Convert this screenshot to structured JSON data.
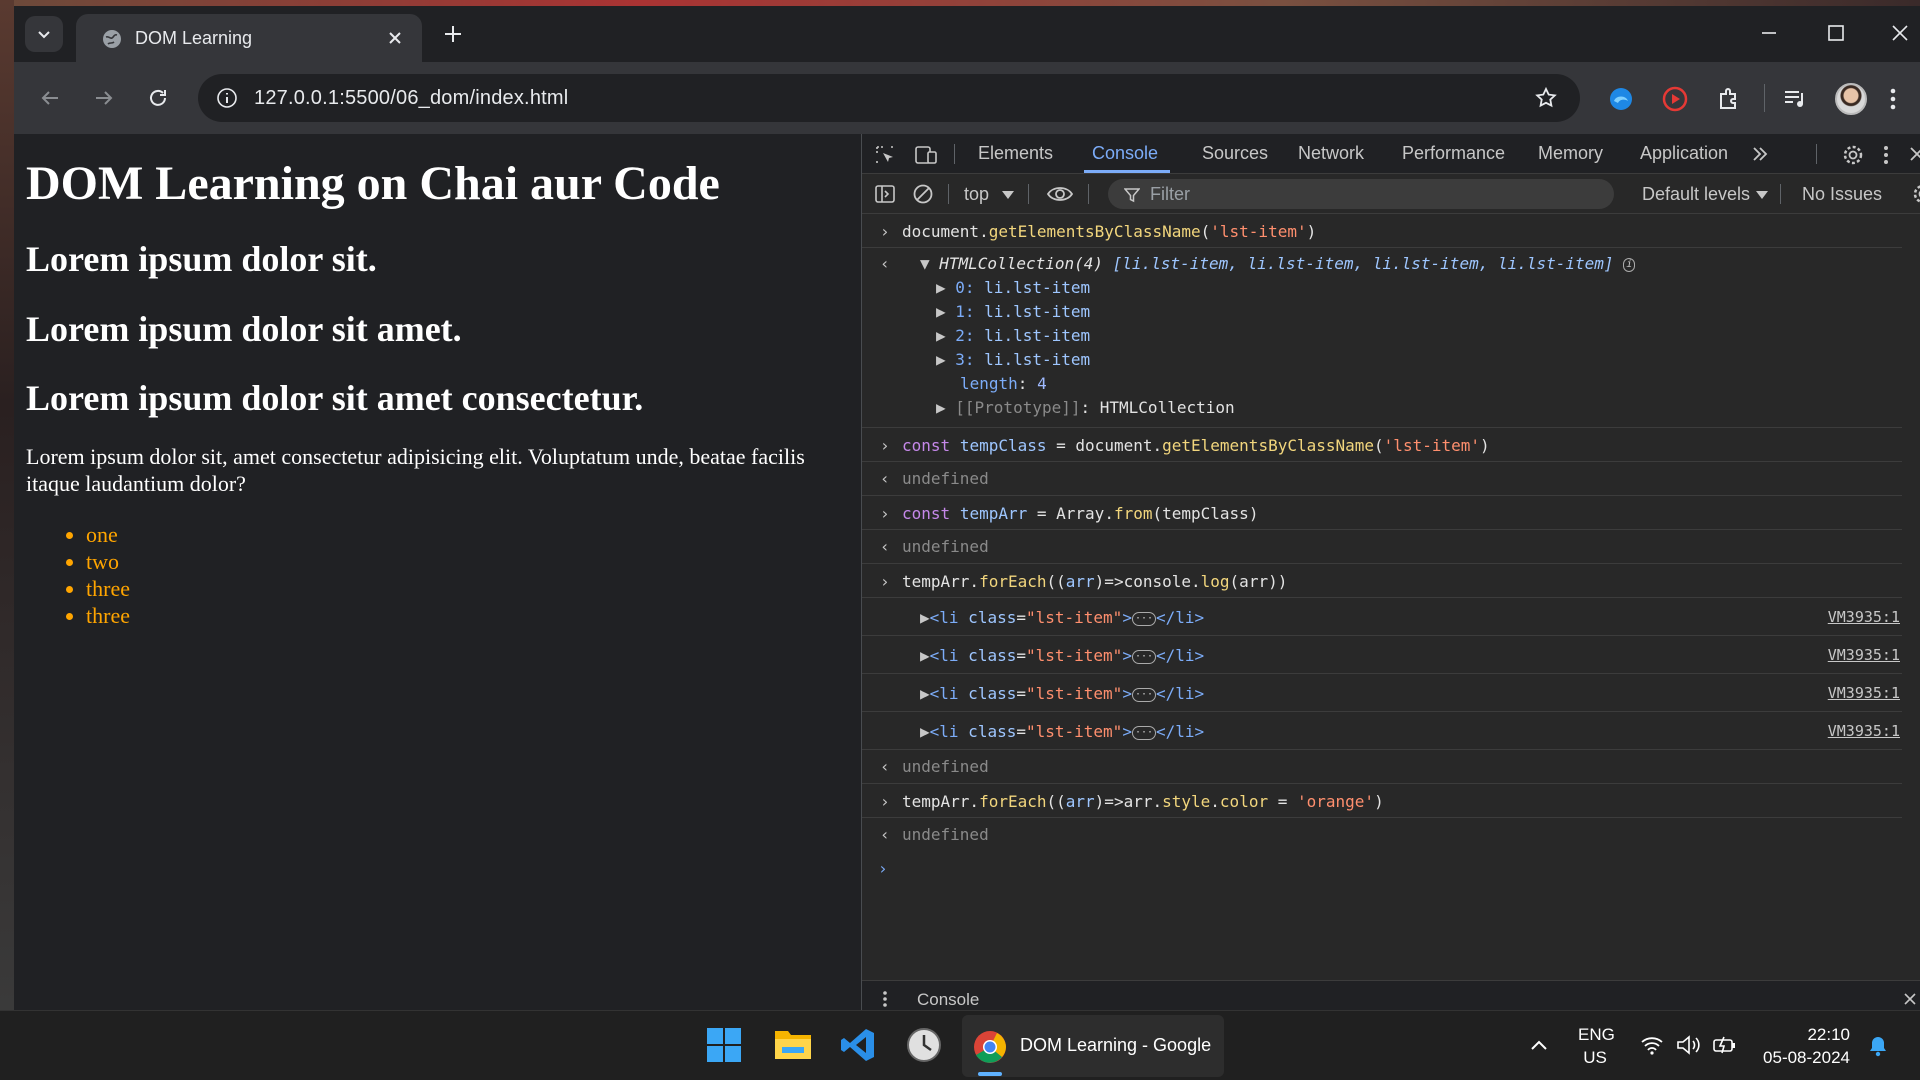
{
  "browser": {
    "tab_title": "DOM Learning",
    "url": "127.0.0.1:5500/06_dom/index.html"
  },
  "page": {
    "h1": "DOM Learning on Chai aur Code",
    "h2": [
      "Lorem ipsum dolor sit.",
      "Lorem ipsum dolor sit amet.",
      "Lorem ipsum dolor sit amet consectetur."
    ],
    "paragraph": "Lorem ipsum dolor sit, amet consectetur adipisicing elit. Voluptatum unde, beatae facilis itaque laudantium dolor?",
    "list": [
      "one",
      "two",
      "three",
      "three"
    ],
    "list_color": "#ffa500"
  },
  "devtools": {
    "tabs": [
      "Elements",
      "Console",
      "Sources",
      "Network",
      "Performance",
      "Memory",
      "Application"
    ],
    "active_tab": "Console",
    "context": "top",
    "filter_placeholder": "Filter",
    "levels": "Default levels",
    "issues": "No Issues",
    "drawer_label": "Console",
    "console": {
      "cmd1": {
        "obj": "document.",
        "fn": "getElementsByClassName",
        "open": "(",
        "arg": "'lst-item'",
        "close": ")"
      },
      "res1": {
        "head": "HTMLCollection(4) ",
        "preview": "[li.lst-item, li.lst-item, li.lst-item, li.lst-item]",
        "items": [
          {
            "key": "0:",
            "val": "li.lst-item"
          },
          {
            "key": "1:",
            "val": "li.lst-item"
          },
          {
            "key": "2:",
            "val": "li.lst-item"
          },
          {
            "key": "3:",
            "val": "li.lst-item"
          }
        ],
        "length_key": "length",
        "length_val": "4",
        "proto_key": "[[Prototype]]",
        "proto_val": "HTMLCollection"
      },
      "cmd2": {
        "kw": "const",
        "var": "tempClass",
        "mid": " = document.",
        "fn": "getElementsByClassName",
        "open": "(",
        "arg": "'lst-item'",
        "close": ")"
      },
      "cmd3": {
        "kw": "const",
        "var": "tempArr",
        "mid": " = Array.",
        "fn": "from",
        "args": "(tempClass)"
      },
      "cmd4": {
        "a": "tempArr.",
        "fn": "forEach",
        "b": "((",
        "p": "arr",
        "c": ")=>console.",
        "fn2": "log",
        "d": "(arr))"
      },
      "logs": [
        {
          "open": "<li",
          "attr": " class",
          "eq": "=",
          "val": "\"lst-item\"",
          "gt": ">",
          "end": "</li>",
          "src": "VM3935:1"
        },
        {
          "open": "<li",
          "attr": " class",
          "eq": "=",
          "val": "\"lst-item\"",
          "gt": ">",
          "end": "</li>",
          "src": "VM3935:1"
        },
        {
          "open": "<li",
          "attr": " class",
          "eq": "=",
          "val": "\"lst-item\"",
          "gt": ">",
          "end": "</li>",
          "src": "VM3935:1"
        },
        {
          "open": "<li",
          "attr": " class",
          "eq": "=",
          "val": "\"lst-item\"",
          "gt": ">",
          "end": "</li>",
          "src": "VM3935:1"
        }
      ],
      "cmd5": {
        "a": "tempArr.",
        "fn": "forEach",
        "b": "((",
        "p": "arr",
        "c": ")=>arr.",
        "s": "style",
        "d": ".",
        "cl": "color",
        "e": " = ",
        "str": "'orange'",
        "f": ")"
      },
      "undefined": "undefined"
    }
  },
  "taskbar": {
    "chrome_label": "DOM Learning - Google",
    "lang1": "ENG",
    "lang2": "US",
    "time": "22:10",
    "date": "05-08-2024"
  }
}
